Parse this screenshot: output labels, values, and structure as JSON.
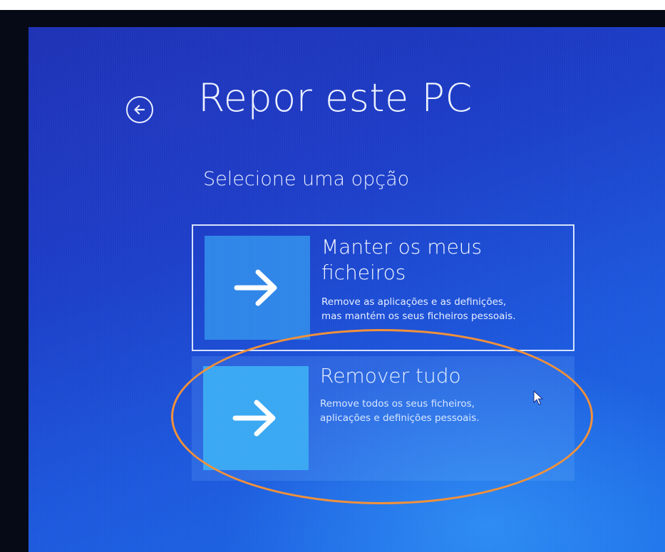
{
  "page": {
    "title": "Repor este PC",
    "subtitle": "Selecione uma opção"
  },
  "options": [
    {
      "title": "Manter os meus ficheiros",
      "desc_line1": "Remove as aplicações e as definições,",
      "desc_line2": "mas mantém os seus ficheiros pessoais."
    },
    {
      "title": "Remover tudo",
      "desc_line1": "Remove todos os seus ficheiros,",
      "desc_line2": "aplicações e definições pessoais."
    }
  ],
  "icons": {
    "back": "back-arrow-circle-icon",
    "option_arrow": "right-arrow-icon",
    "cursor": "mouse-pointer-icon"
  },
  "colors": {
    "screen_background": "#1c3ec8",
    "tile": "#2f86e8",
    "tile_highlight": "#3aa8f2",
    "annotation": "#f2913a",
    "text": "#eef3ff"
  }
}
